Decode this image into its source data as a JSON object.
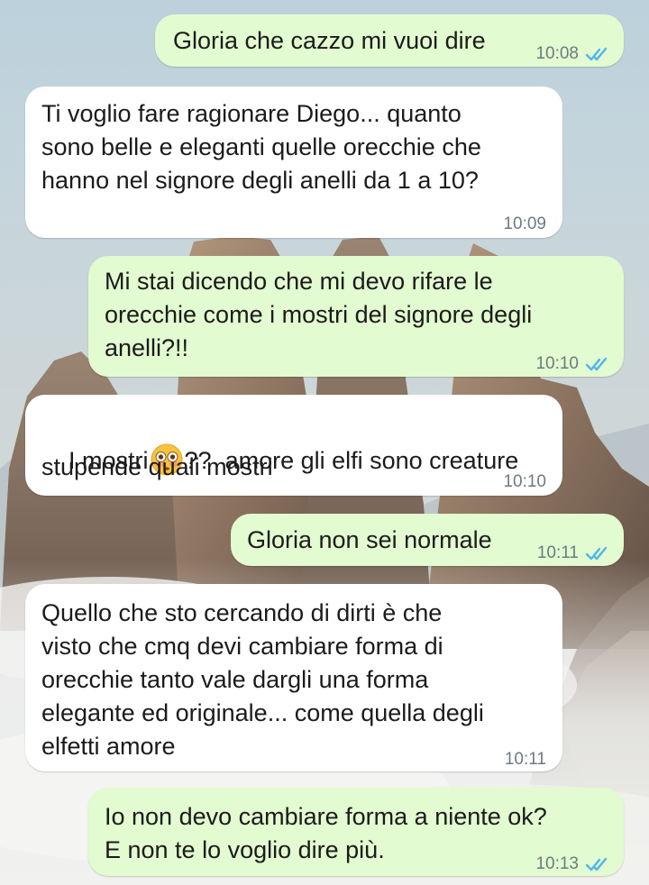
{
  "chat": {
    "messages": [
      {
        "direction": "outgoing",
        "text": "Gloria che cazzo mi vuoi dire",
        "time": "10:08",
        "status_icon": "double-check-read-icon"
      },
      {
        "direction": "incoming",
        "lines": [
          "Ti voglio fare ragionare Diego... quanto",
          "sono belle e eleganti quelle orecchie che",
          "hanno nel signore degli anelli da 1 a 10?"
        ],
        "time": "10:09"
      },
      {
        "direction": "outgoing",
        "lines": [
          "Mi stai dicendo che mi devo rifare le",
          "orecchie come i mostri del signore degli",
          "anelli?!!"
        ],
        "time": "10:10",
        "status_icon": "double-check-read-icon"
      },
      {
        "direction": "incoming",
        "line1_before": "I mostri",
        "emoji": "flushed-face-emoji",
        "line1_after": "??  amore gli elfi sono creature",
        "line2": "stupende quali mostri",
        "time": "10:10"
      },
      {
        "direction": "outgoing",
        "text": "Gloria non sei normale",
        "time": "10:11",
        "status_icon": "double-check-read-icon"
      },
      {
        "direction": "incoming",
        "lines": [
          "Quello che sto cercando di dirti è che",
          "visto che cmq devi cambiare forma di",
          "orecchie tanto vale dargli una forma",
          "elegante ed originale... come quella degli",
          "elfetti amore"
        ],
        "time": "10:11"
      },
      {
        "direction": "outgoing",
        "lines": [
          "Io non devo cambiare forma a niente ok?",
          "E non te lo voglio dire più."
        ],
        "time": "10:13",
        "status_icon": "double-check-read-icon"
      }
    ]
  },
  "colors": {
    "outgoing_bubble": "#e2fbd0",
    "incoming_bubble": "#ffffff",
    "read_tick": "#4fb6ec",
    "timestamp": "#6f7a80"
  }
}
